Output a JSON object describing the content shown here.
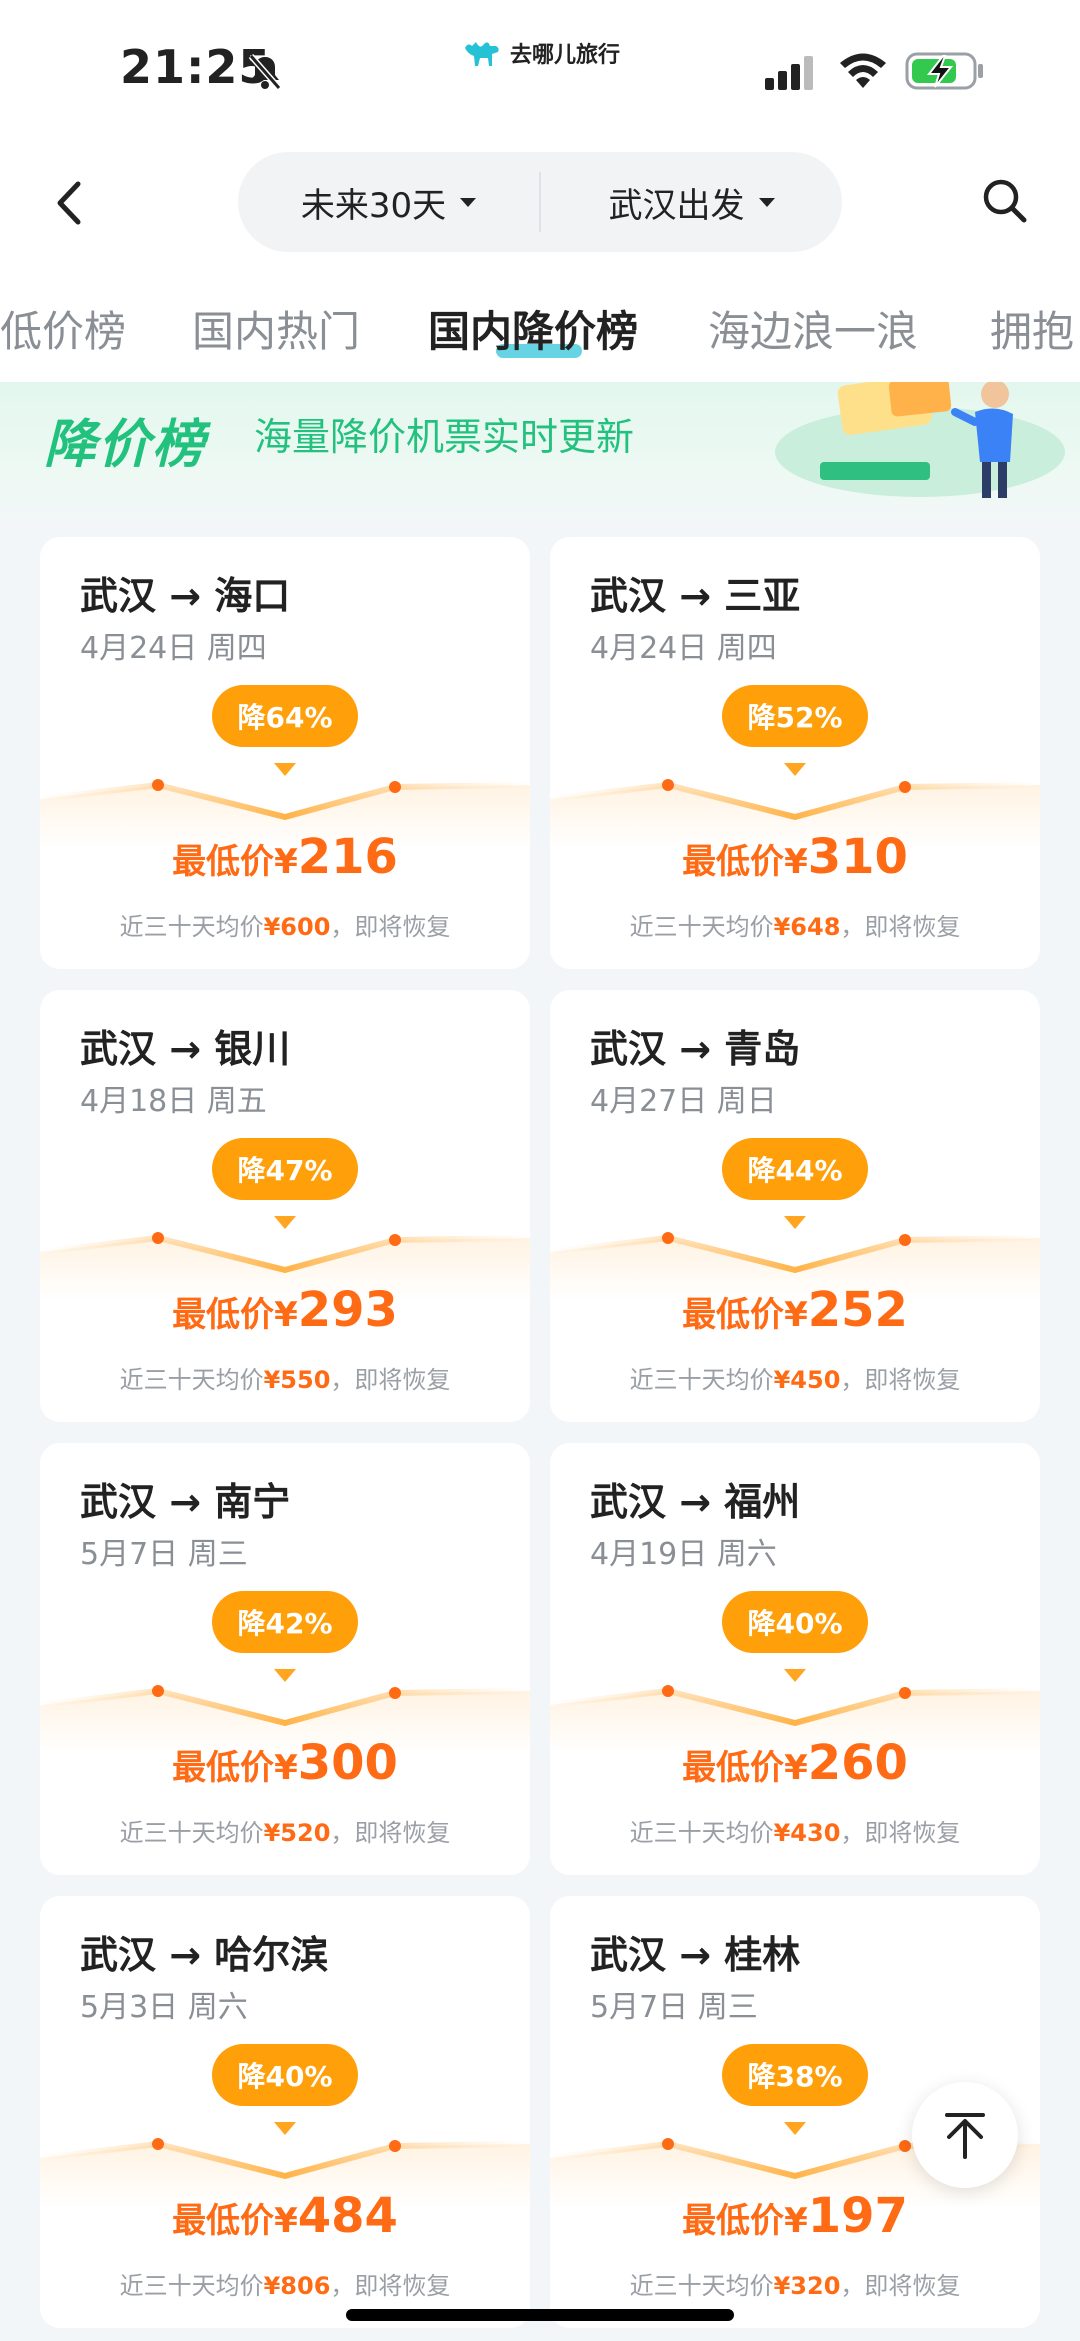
{
  "status_bar": {
    "time": "21:25",
    "brand": "去哪儿旅行"
  },
  "header": {
    "date_range": "未来30天",
    "departure": "武汉出发"
  },
  "tabs": [
    {
      "label": "低价榜",
      "active": false
    },
    {
      "label": "国内热门",
      "active": false
    },
    {
      "label": "国内降价榜",
      "active": true
    },
    {
      "label": "海边浪一浪",
      "active": false
    },
    {
      "label": "拥抱",
      "active": false
    }
  ],
  "banner": {
    "title": "降价榜",
    "subtitle": "海量降价机票实时更新"
  },
  "labels": {
    "lowest_price": "最低价",
    "currency": "¥",
    "avg_prefix": "近三十天均价",
    "avg_suffix": "，即将恢复"
  },
  "deals": [
    {
      "route": "武汉 → 海口",
      "date": "4月24日 周四",
      "drop": "降64%",
      "price": "216",
      "avg": "600"
    },
    {
      "route": "武汉 → 三亚",
      "date": "4月24日 周四",
      "drop": "降52%",
      "price": "310",
      "avg": "648"
    },
    {
      "route": "武汉 → 银川",
      "date": "4月18日 周五",
      "drop": "降47%",
      "price": "293",
      "avg": "550"
    },
    {
      "route": "武汉 → 青岛",
      "date": "4月27日 周日",
      "drop": "降44%",
      "price": "252",
      "avg": "450"
    },
    {
      "route": "武汉 → 南宁",
      "date": "5月7日 周三",
      "drop": "降42%",
      "price": "300",
      "avg": "520"
    },
    {
      "route": "武汉 → 福州",
      "date": "4月19日 周六",
      "drop": "降40%",
      "price": "260",
      "avg": "430"
    },
    {
      "route": "武汉 → 哈尔滨",
      "date": "5月3日 周六",
      "drop": "降40%",
      "price": "484",
      "avg": "806"
    },
    {
      "route": "武汉 → 桂林",
      "date": "5月7日 周三",
      "drop": "降38%",
      "price": "197",
      "avg": "320"
    }
  ],
  "colors": {
    "accent_orange": "#ff9f0a",
    "price_orange": "#ff6a14",
    "brand_green": "#22c17e",
    "tab_indicator": "#25c2d6"
  },
  "icons": [
    "bell-mute-icon",
    "camel-logo-icon",
    "signal-icon",
    "wifi-icon",
    "battery-charging-icon",
    "back-arrow-icon",
    "search-icon",
    "back-to-top-icon"
  ]
}
